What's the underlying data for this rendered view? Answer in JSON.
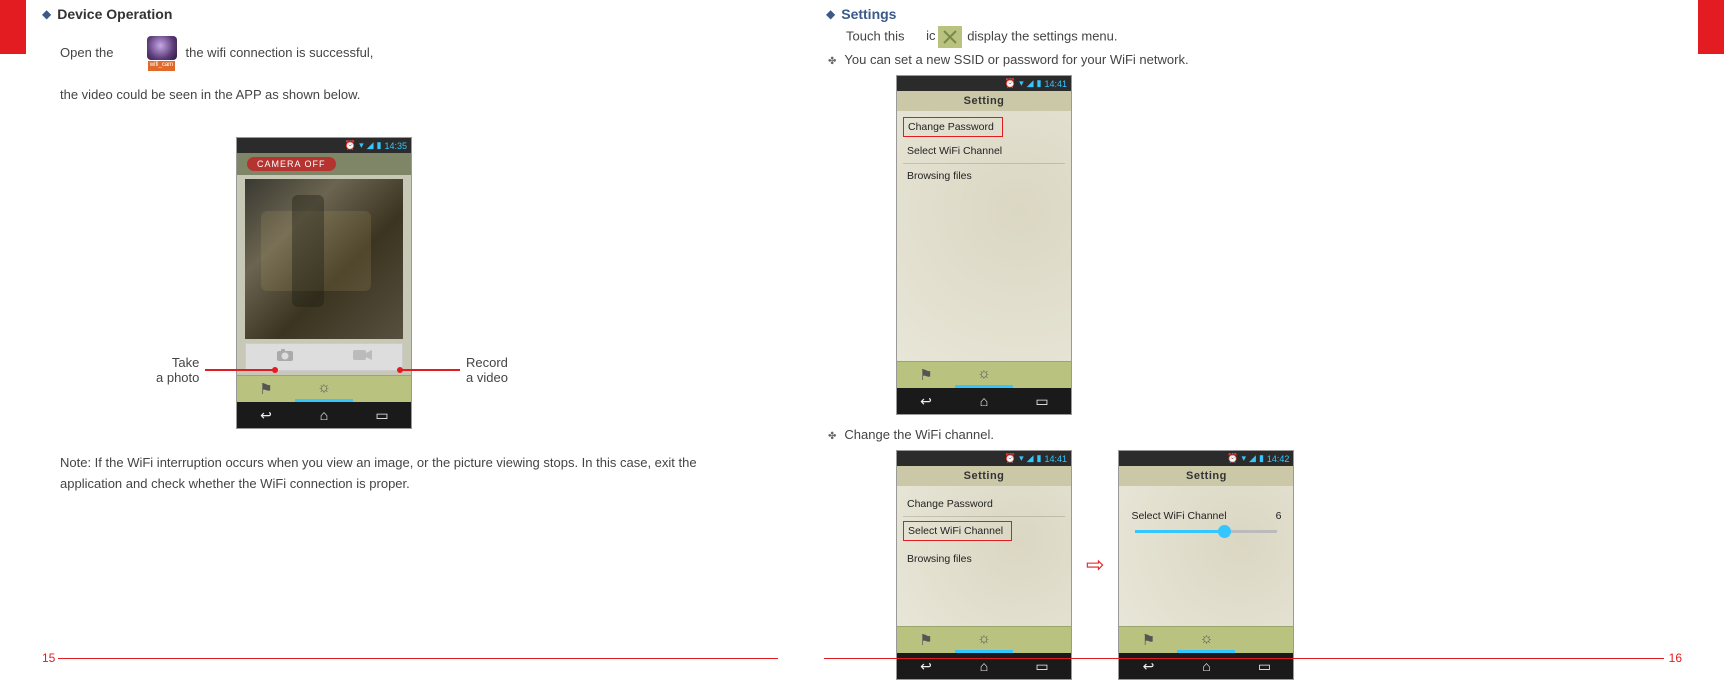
{
  "left": {
    "heading": "Device Operation",
    "line1a": "Open the",
    "line1b": "the wifi connection is successful,",
    "line2": "the video could be seen in the APP as shown below.",
    "note": "Note: If the WiFi interruption occurs when you view an image, or the picture viewing stops. In this case, exit the application and check whether the WiFi connection is proper.",
    "anno_left_l1": "Take",
    "anno_left_l2": "a photo",
    "anno_right_l1": "Record",
    "anno_right_l2": "a video",
    "phone_time": "14:35",
    "cam_off": "CAMERA OFF",
    "app_label": "wifi_cam"
  },
  "right": {
    "heading": "Settings",
    "line1a": "Touch this",
    "line1b_mid": "icon",
    "line1c": "display the settings menu.",
    "bullet1": "You can set a new SSID or password for your WiFi network.",
    "bullet2": "Change the WiFi channel.",
    "setting_title": "Setting",
    "menu_change_pw": "Change Password",
    "menu_select_ch": "Select WiFi Channel",
    "menu_browse": "Browsing files",
    "phone_time1": "14:41",
    "phone_time2": "14:42",
    "channel_value": "6"
  },
  "footer": {
    "page_left": "15",
    "page_right": "16"
  }
}
